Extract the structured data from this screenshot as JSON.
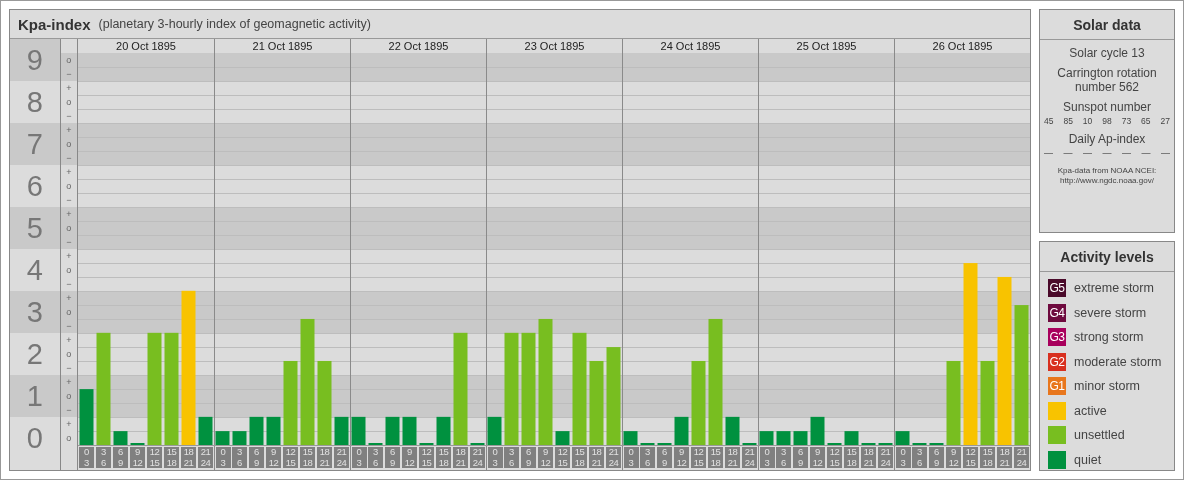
{
  "kpa_panel": {
    "title": "Kpa-index",
    "subtitle": "(planetary 3-hourly index of geomagnetic activity)",
    "days": [
      "20 Oct 1895",
      "21 Oct 1895",
      "22 Oct 1895",
      "23 Oct 1895",
      "24 Oct 1895",
      "25 Oct 1895",
      "26 Oct 1895"
    ],
    "kp_marks": [
      "o",
      "−",
      "+",
      "o",
      "−",
      "+",
      "o",
      "−",
      "+",
      "o",
      "−",
      "+",
      "o",
      "−",
      "+",
      "o",
      "−",
      "+",
      "o",
      "−",
      "+",
      "o",
      "−",
      "+",
      "o",
      "−",
      "+",
      "o"
    ],
    "chart_data": {
      "type": "bar",
      "grid": true,
      "ylim": [
        0,
        9.33
      ],
      "yticks": [
        9,
        8,
        7,
        6,
        5,
        4,
        3,
        2,
        1,
        0
      ],
      "categories": [
        "0 3",
        "3 6",
        "6 9",
        "9 12",
        "12 15",
        "15 18",
        "18 21",
        "21 24",
        "0 3",
        "3 6",
        "6 9",
        "9 12",
        "12 15",
        "15 18",
        "18 21",
        "21 24",
        "0 3",
        "3 6",
        "6 9",
        "9 12",
        "12 15",
        "15 18",
        "18 21",
        "21 24",
        "0 3",
        "3 6",
        "6 9",
        "9 12",
        "12 15",
        "15 18",
        "18 21",
        "21 24",
        "0 3",
        "3 6",
        "6 9",
        "9 12",
        "12 15",
        "15 18",
        "18 21",
        "21 24",
        "0 3",
        "3 6",
        "6 9",
        "9 12",
        "12 15",
        "15 18",
        "18 21",
        "21 24",
        "0 3",
        "3 6",
        "6 9",
        "9 12",
        "12 15",
        "15 18",
        "18 21",
        "21 24"
      ],
      "series": [
        {
          "color": "#00913f",
          "values": [
            1.33,
            null,
            0.33,
            0,
            null,
            null,
            null,
            0.67,
            0.33,
            0.33,
            0.67,
            0.67,
            null,
            null,
            null,
            0.67,
            0.67,
            0,
            0.67,
            0.67,
            0,
            0.67,
            null,
            0,
            0.67,
            null,
            null,
            null,
            0.33,
            null,
            null,
            null,
            0.33,
            0,
            0,
            0.67,
            null,
            null,
            0.67,
            0,
            0.33,
            0.33,
            0.33,
            0.67,
            0,
            0.33,
            0,
            0,
            0.33,
            0,
            0,
            null,
            null,
            null,
            null,
            null
          ]
        },
        {
          "color": "#78be20",
          "values": [
            null,
            2.67,
            null,
            null,
            2.67,
            2.67,
            null,
            null,
            null,
            null,
            null,
            null,
            2,
            3,
            2,
            null,
            null,
            null,
            null,
            null,
            null,
            null,
            2.67,
            null,
            null,
            2.67,
            2.67,
            3,
            null,
            2.67,
            2,
            2.33,
            null,
            null,
            null,
            null,
            2,
            3,
            null,
            null,
            null,
            null,
            null,
            null,
            null,
            null,
            null,
            null,
            null,
            null,
            null,
            2,
            null,
            2,
            null,
            3.33
          ]
        },
        {
          "color": "#f8c300",
          "values": [
            null,
            null,
            null,
            null,
            null,
            null,
            3.67,
            null,
            null,
            null,
            null,
            null,
            null,
            null,
            null,
            null,
            null,
            null,
            null,
            null,
            null,
            null,
            null,
            null,
            null,
            null,
            null,
            null,
            null,
            null,
            null,
            null,
            null,
            null,
            null,
            null,
            null,
            null,
            null,
            null,
            null,
            null,
            null,
            null,
            null,
            null,
            null,
            null,
            null,
            null,
            null,
            null,
            4.33,
            null,
            4,
            null
          ]
        }
      ]
    }
  },
  "solar_data": {
    "title": "Solar data",
    "solar_cycle": "Solar cycle 13",
    "carrington": "Carrington rotation number 562",
    "sunspot_heading": "Sunspot number",
    "sunspot_numbers": [
      "45",
      "85",
      "10",
      "98",
      "73",
      "65",
      "27"
    ],
    "ap_heading": "Daily Ap-index",
    "ap_values": [
      "—",
      "—",
      "—",
      "—",
      "—",
      "—",
      "—"
    ],
    "source_note": "Kpa-data from NOAA NCEI:",
    "source_url": "http://www.ngdc.noaa.gov/"
  },
  "activity_levels": {
    "title": "Activity levels",
    "items": [
      {
        "badge": "G5",
        "label": "extreme storm",
        "color": "#4a0a2a"
      },
      {
        "badge": "G4",
        "label": "severe storm",
        "color": "#6e0a3e"
      },
      {
        "badge": "G3",
        "label": "strong storm",
        "color": "#a8005c"
      },
      {
        "badge": "G2",
        "label": "moderate storm",
        "color": "#d8301f"
      },
      {
        "badge": "G1",
        "label": "minor storm",
        "color": "#e8761c"
      },
      {
        "label": "active",
        "color": "#f8c300"
      },
      {
        "label": "unsettled",
        "color": "#78be20"
      },
      {
        "label": "quiet",
        "color": "#00913f"
      }
    ]
  }
}
